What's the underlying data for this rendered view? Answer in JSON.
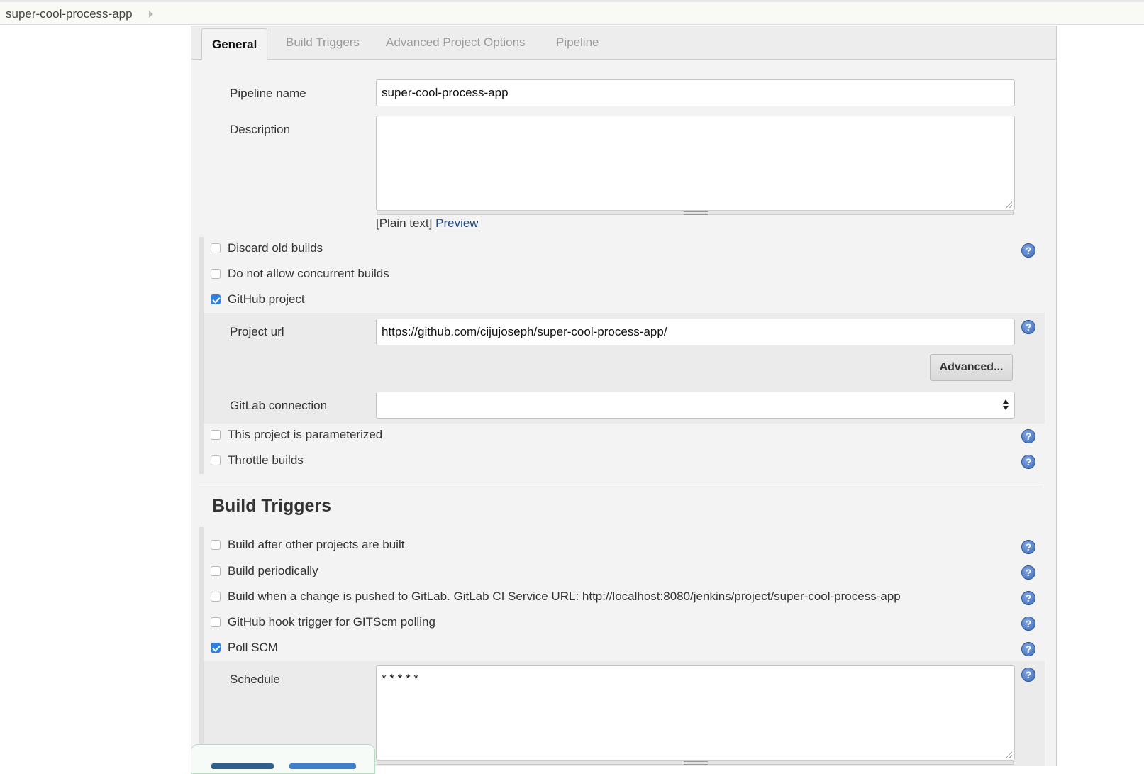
{
  "breadcrumb": {
    "project": "super-cool-process-app"
  },
  "tabs": [
    {
      "label": "General",
      "active": true
    },
    {
      "label": "Build Triggers",
      "active": false
    },
    {
      "label": "Advanced Project Options",
      "active": false
    },
    {
      "label": "Pipeline",
      "active": false
    }
  ],
  "general": {
    "pipeline_name_label": "Pipeline name",
    "pipeline_name_value": "super-cool-process-app",
    "description_label": "Description",
    "description_value": "",
    "plain_text": "[Plain text]",
    "preview_link": "Preview",
    "options": [
      {
        "label": "Discard old builds",
        "checked": false
      },
      {
        "label": "Do not allow concurrent builds",
        "checked": false
      },
      {
        "label": "GitHub project",
        "checked": true
      }
    ],
    "github": {
      "project_url_label": "Project url",
      "project_url_value": "https://github.com/cijujoseph/super-cool-process-app/",
      "advanced_button": "Advanced...",
      "gitlab_connection_label": "GitLab connection",
      "gitlab_connection_value": ""
    },
    "more_options": [
      {
        "label": "This project is parameterized",
        "checked": false
      },
      {
        "label": "Throttle builds",
        "checked": false
      }
    ]
  },
  "build_triggers": {
    "title": "Build Triggers",
    "options": [
      {
        "label": "Build after other projects are built",
        "checked": false
      },
      {
        "label": "Build periodically",
        "checked": false
      },
      {
        "label": "Build when a change is pushed to GitLab. GitLab CI Service URL: http://localhost:8080/jenkins/project/super-cool-process-app",
        "checked": false
      },
      {
        "label": "GitHub hook trigger for GITScm polling",
        "checked": false
      },
      {
        "label": "Poll SCM",
        "checked": true
      }
    ],
    "schedule_label": "Schedule",
    "schedule_value": "* * * * *"
  },
  "help_glyph": "?",
  "colors": {
    "checkbox_checked": "#2f7fe0",
    "help_icon": "#3f6bb8",
    "link": "#204a87"
  }
}
